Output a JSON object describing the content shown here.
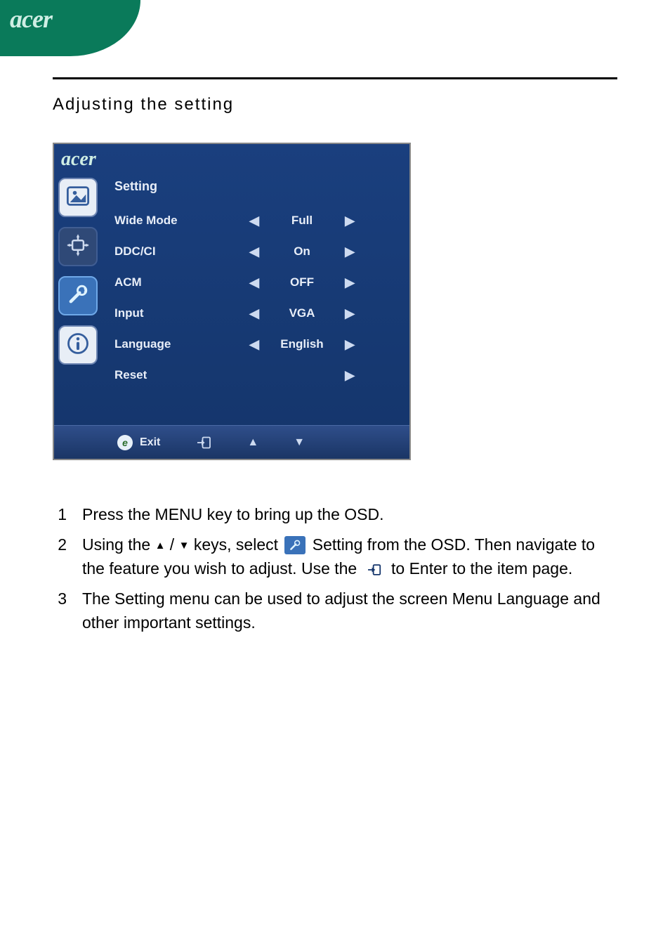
{
  "brand_name": "acer",
  "page": {
    "title": "Adjusting  the  setting"
  },
  "osd": {
    "brand": "acer",
    "heading": "Setting",
    "rows": [
      {
        "label": "Wide Mode",
        "value": "Full",
        "has_left": true,
        "has_right": true
      },
      {
        "label": "DDC/CI",
        "value": "On",
        "has_left": true,
        "has_right": true
      },
      {
        "label": "ACM",
        "value": "OFF",
        "has_left": true,
        "has_right": true
      },
      {
        "label": "Input",
        "value": "VGA",
        "has_left": true,
        "has_right": true
      },
      {
        "label": "Language",
        "value": "English",
        "has_left": true,
        "has_right": true
      },
      {
        "label": "Reset",
        "value": "",
        "has_left": false,
        "has_right": true
      }
    ],
    "footer": {
      "exit_label": "Exit"
    }
  },
  "instructions": {
    "items": [
      {
        "num": "1",
        "text_a": "Press the MENU key to bring up the OSD."
      },
      {
        "num": "2",
        "text_a": "Using the ",
        "text_b": " / ",
        "text_c": " keys, select ",
        "text_d": " Setting from the OSD. Then navigate to the feature you wish to adjust. Use the ",
        "text_e": " to Enter to the item page."
      },
      {
        "num": "3",
        "text_a": "The Setting menu can be used to adjust the screen Menu Language and other important settings."
      }
    ]
  }
}
